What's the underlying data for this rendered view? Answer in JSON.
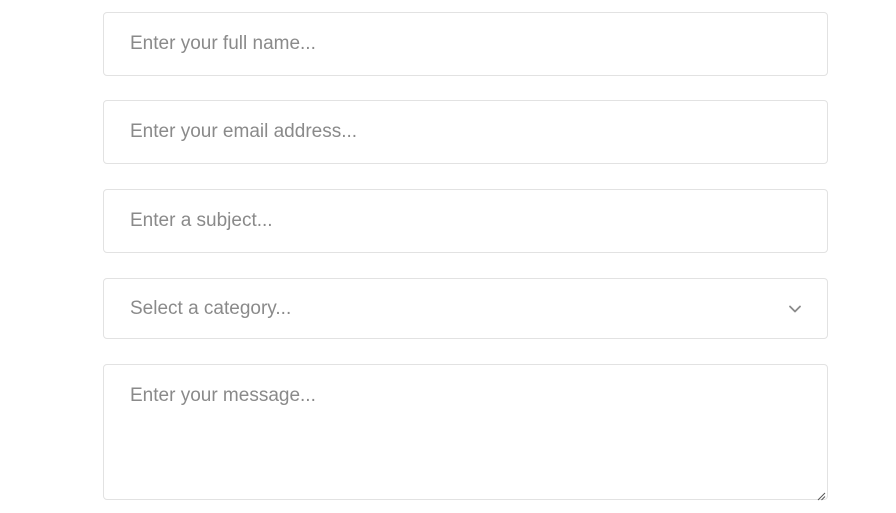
{
  "form": {
    "full_name": {
      "placeholder": "Enter your full name...",
      "value": ""
    },
    "email": {
      "placeholder": "Enter your email address...",
      "value": ""
    },
    "subject": {
      "placeholder": "Enter a subject...",
      "value": ""
    },
    "category": {
      "selected_label": "Select a category...",
      "icon": "chevron-down-icon"
    },
    "message": {
      "placeholder": "Enter your message...",
      "value": ""
    }
  },
  "colors": {
    "border": "#e2e2e2",
    "placeholder": "#8a8a8a",
    "background": "#ffffff"
  }
}
